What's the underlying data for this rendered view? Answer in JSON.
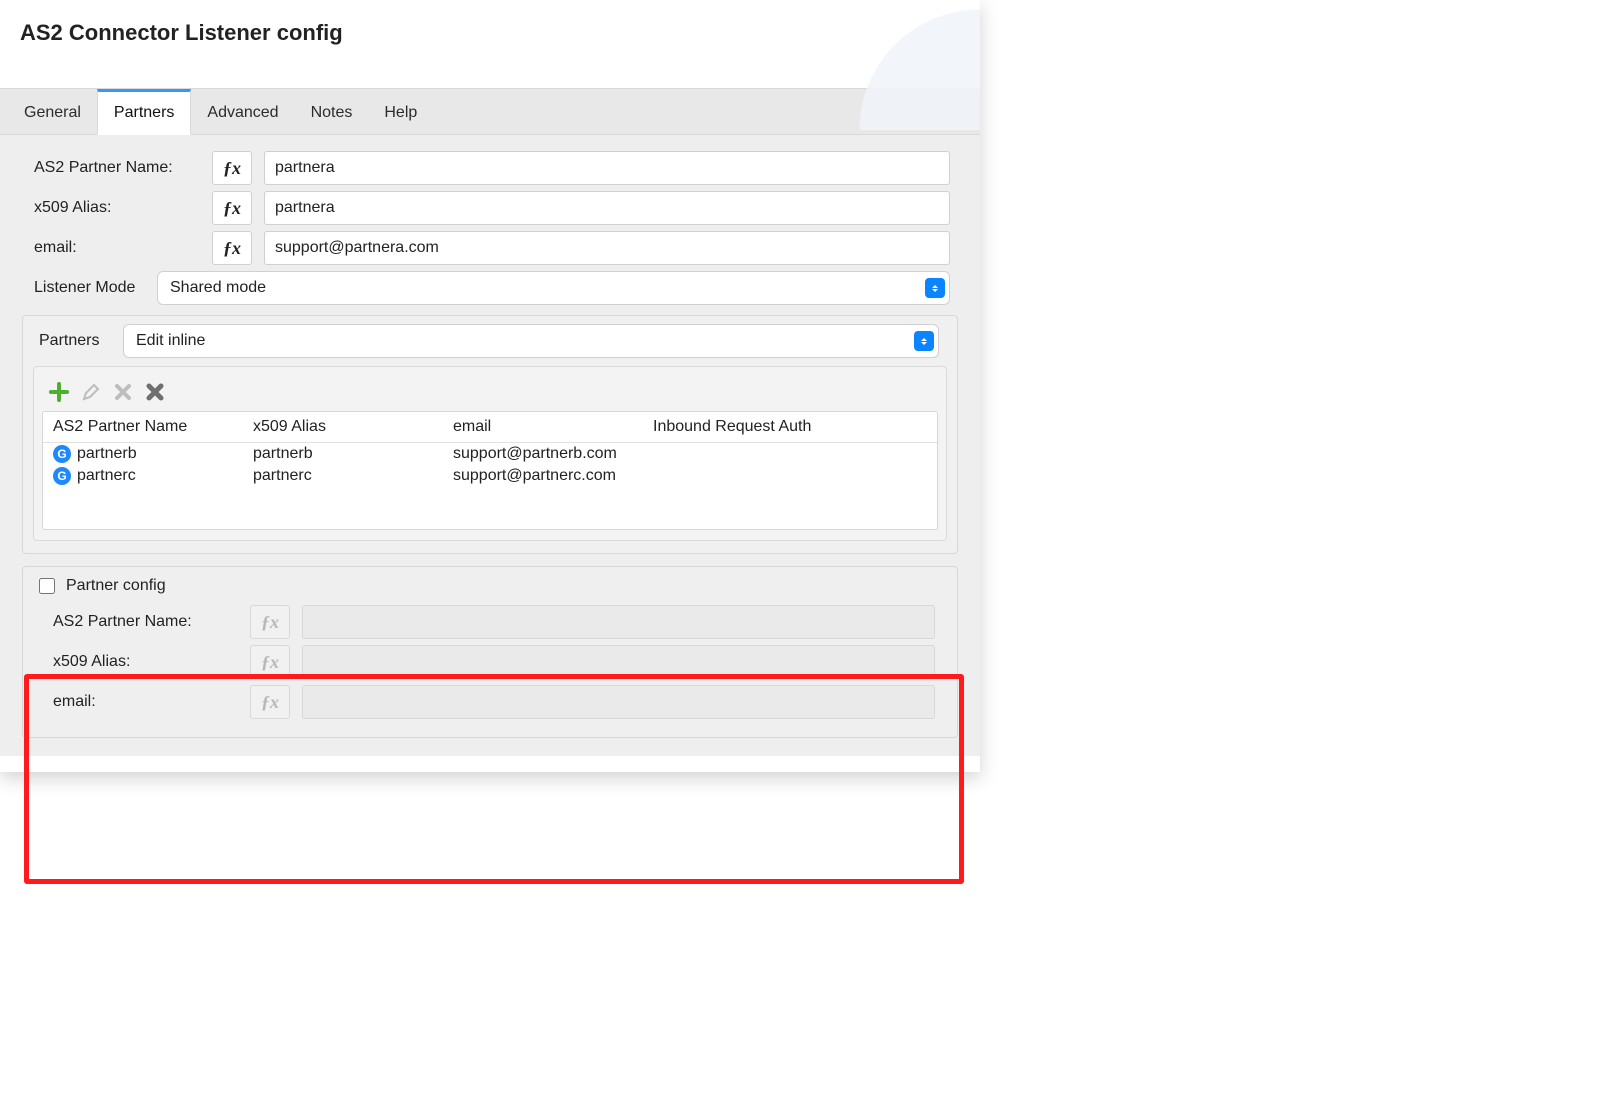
{
  "window_title": "AS2 Connector Listener config",
  "tabs": [
    {
      "label": "General",
      "active": false
    },
    {
      "label": "Partners",
      "active": true
    },
    {
      "label": "Advanced",
      "active": false
    },
    {
      "label": "Notes",
      "active": false
    },
    {
      "label": "Help",
      "active": false
    }
  ],
  "fields": {
    "as2_partner_name": {
      "label": "AS2 Partner Name:",
      "value": "partnera"
    },
    "x509_alias": {
      "label": "x509 Alias:",
      "value": "partnera"
    },
    "email": {
      "label": "email:",
      "value": "support@partnera.com"
    }
  },
  "listener_mode": {
    "label": "Listener Mode",
    "value": "Shared mode"
  },
  "partners_group": {
    "label": "Partners",
    "mode": "Edit inline",
    "toolbar": {
      "add": "add-icon",
      "edit": "edit-icon",
      "delete": "delete-icon",
      "clear": "clear-icon"
    },
    "columns": [
      "AS2 Partner Name",
      "x509 Alias",
      "email",
      "Inbound Request Auth"
    ],
    "rows": [
      {
        "name": "partnerb",
        "alias": "partnerb",
        "email": "support@partnerb.com",
        "auth": ""
      },
      {
        "name": "partnerc",
        "alias": "partnerc",
        "email": "support@partnerc.com",
        "auth": ""
      }
    ]
  },
  "partner_config": {
    "title": "Partner config",
    "checked": false,
    "fields": {
      "as2_partner_name": {
        "label": "AS2 Partner Name:",
        "value": ""
      },
      "x509_alias": {
        "label": "x509 Alias:",
        "value": ""
      },
      "email": {
        "label": "email:",
        "value": ""
      }
    }
  },
  "fx_label": "ƒx"
}
